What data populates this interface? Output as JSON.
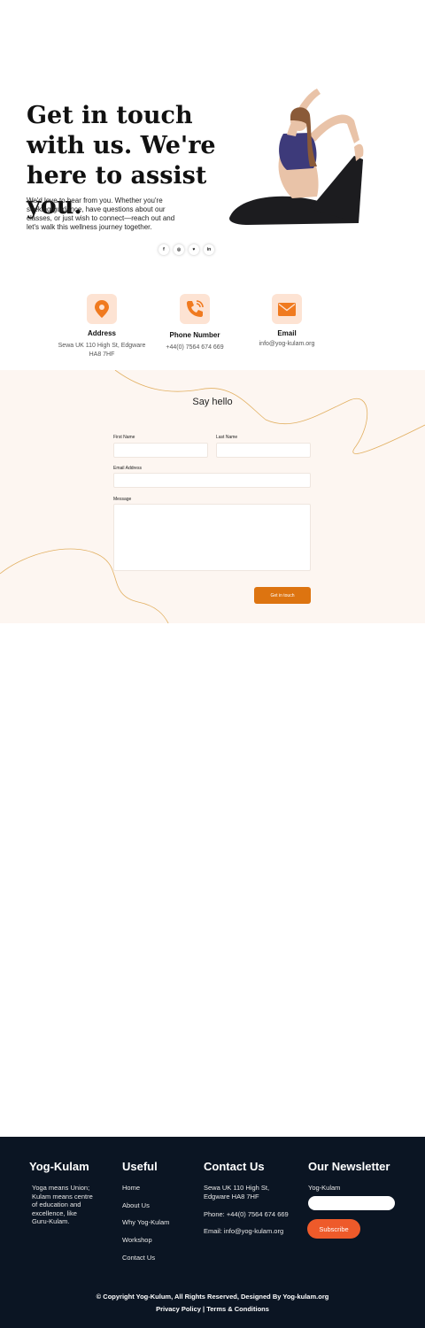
{
  "hero": {
    "title": "Get in touch with us. We're here to assist you.",
    "description": "We'd love to hear from you. Whether you're seeking guidance, have questions about our classes, or just wish to connect—reach out and let's walk this wellness journey together.",
    "socials": [
      {
        "icon": "facebook-icon",
        "glyph": "f"
      },
      {
        "icon": "instagram-icon",
        "glyph": "◎"
      },
      {
        "icon": "twitter-icon",
        "glyph": "♥"
      },
      {
        "icon": "linkedin-icon",
        "glyph": "in"
      }
    ]
  },
  "contact_info": {
    "address": {
      "title": "Address",
      "text": "Sewa UK 110 High St, Edgware HA8 7HF",
      "icon": "location-pin-icon"
    },
    "phone": {
      "title": "Phone Number",
      "text": "+44(0) 7564 674 669",
      "icon": "phone-icon"
    },
    "email": {
      "title": "Email",
      "text": "info@yog-kulam.org",
      "icon": "envelope-icon"
    }
  },
  "form": {
    "title": "Say hello",
    "first_name_label": "First Name",
    "last_name_label": "Last Name",
    "email_label": "Email Address",
    "message_label": "Message",
    "first_name_value": "",
    "last_name_value": "",
    "email_value": "",
    "message_value": "",
    "submit_label": "Get in touch"
  },
  "footer": {
    "brand": {
      "title": "Yog-Kulam",
      "text": "Yoga means Union; Kulam means centre of education and excellence, like Guru-Kulam."
    },
    "useful": {
      "title": "Useful",
      "links": [
        "Home",
        "About Us",
        "Why Yog-Kulam",
        "Workshop",
        "Contact Us"
      ]
    },
    "contact": {
      "title": "Contact Us",
      "address": "Sewa UK 110 High St, Edgware HA8 7HF",
      "phone": "Phone: +44(0) 7564 674 669",
      "email": "Email: info@yog-kulam.org"
    },
    "newsletter": {
      "title": "Our Newsletter",
      "label": "Yog-Kulam",
      "input_value": "",
      "button_label": "Subscribe"
    },
    "copyright": "© Copyright Yog-Kulum, All Rights Reserved,  Designed By Yog-kulam.org",
    "legal": "Privacy Policy | Terms & Conditions"
  },
  "colors": {
    "accent_orange": "#f07a1f",
    "button_orange": "#dd7410",
    "subscribe_orange": "#ee5a2a",
    "footer_bg": "#0b1523",
    "form_bg": "#fdf6f1"
  }
}
